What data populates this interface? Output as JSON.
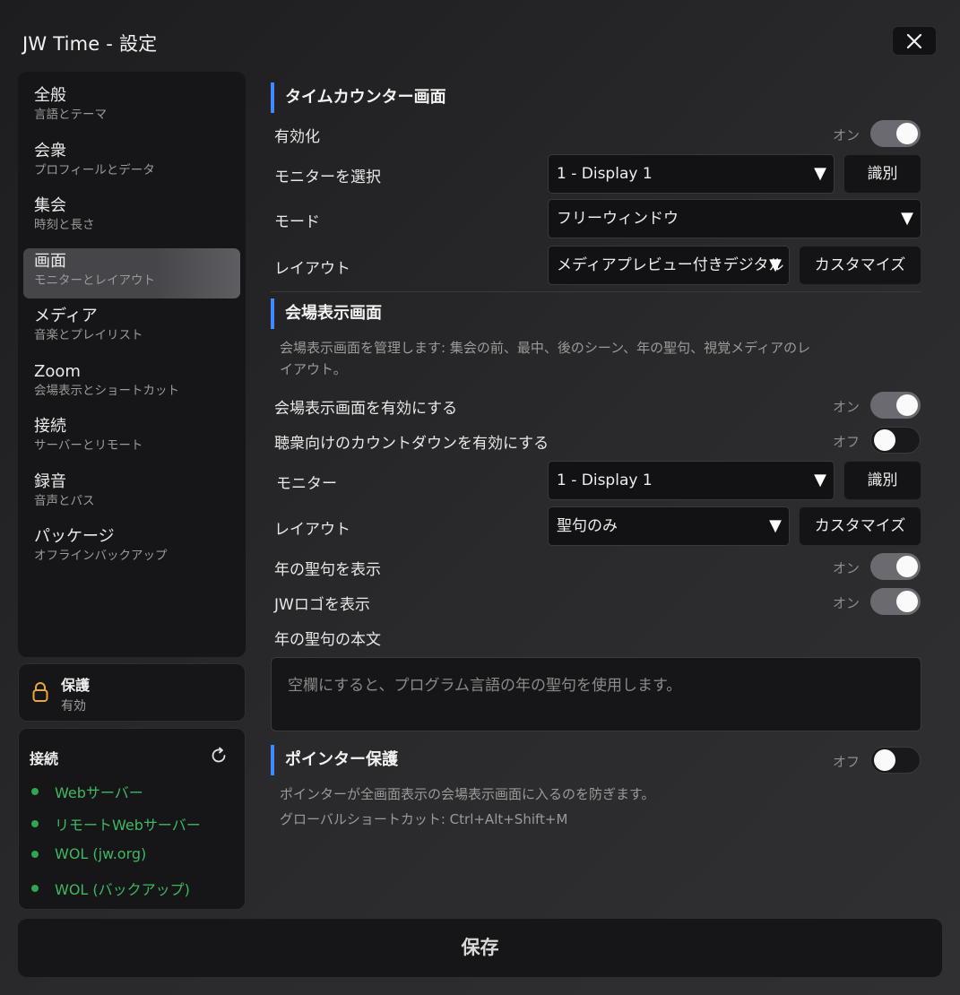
{
  "window": {
    "title": "JW Time - 設定"
  },
  "sidebar": {
    "items": [
      {
        "label": "全般",
        "sub": "言語とテーマ"
      },
      {
        "label": "会衆",
        "sub": "プロフィールとデータ"
      },
      {
        "label": "集会",
        "sub": "時刻と長さ"
      },
      {
        "label": "画面",
        "sub": "モニターとレイアウト"
      },
      {
        "label": "メディア",
        "sub": "音楽とプレイリスト"
      },
      {
        "label": "Zoom",
        "sub": "会場表示とショートカット"
      },
      {
        "label": "接続",
        "sub": "サーバーとリモート"
      },
      {
        "label": "録音",
        "sub": "音声とパス"
      },
      {
        "label": "パッケージ",
        "sub": "オフラインバックアップ"
      }
    ],
    "active_index": 3
  },
  "protection": {
    "title": "保護",
    "status": "有効"
  },
  "connection": {
    "title": "接続",
    "items": [
      "Webサーバー",
      "リモートWebサーバー",
      "WOL (jw.org)",
      "WOL (バックアップ)"
    ],
    "status_color": "#2fa651"
  },
  "timer_section": {
    "title": "タイムカウンター画面",
    "enable_label": "有効化",
    "enable_state": "オン",
    "monitor_label": "モニターを選択",
    "monitor_value": "1 - Display 1",
    "identify": "識別",
    "mode_label": "モード",
    "mode_value": "フリーウィンドウ",
    "layout_label": "レイアウト",
    "layout_value": "メディアプレビュー付きデジタル",
    "customize": "カスタマイズ"
  },
  "venue_section": {
    "title": "会場表示画面",
    "description": [
      "会場表示画面を管理します: 集会の前、最中、後のシーン、年の聖句、視覚メディアのレ",
      "イアウト。"
    ],
    "enable_label": "会場表示画面を有効にする",
    "enable_state": "オン",
    "countdown_label": "聴衆向けのカウントダウンを有効にする",
    "countdown_state": "オフ",
    "monitor_label": "モニター",
    "monitor_value": "1 - Display 1",
    "identify": "識別",
    "layout_label": "レイアウト",
    "layout_value": "聖句のみ",
    "customize": "カスタマイズ",
    "yeartext_label": "年の聖句を表示",
    "yeartext_state": "オン",
    "logo_label": "JWロゴを表示",
    "logo_state": "オン",
    "yeartext_body_label": "年の聖句の本文",
    "yeartext_placeholder": "空欄にすると、プログラム言語の年の聖句を使用します。"
  },
  "pointer_section": {
    "title": "ポインター保護",
    "state": "オフ",
    "description": "ポインターが全画面表示の会場表示画面に入るのを防ぎます。",
    "shortcut": "グローバルショートカット: Ctrl+Alt+Shift+M"
  },
  "footer": {
    "save_label": "保存"
  },
  "colors": {
    "accent": "#3d8bff",
    "status_green": "#3fb861"
  }
}
